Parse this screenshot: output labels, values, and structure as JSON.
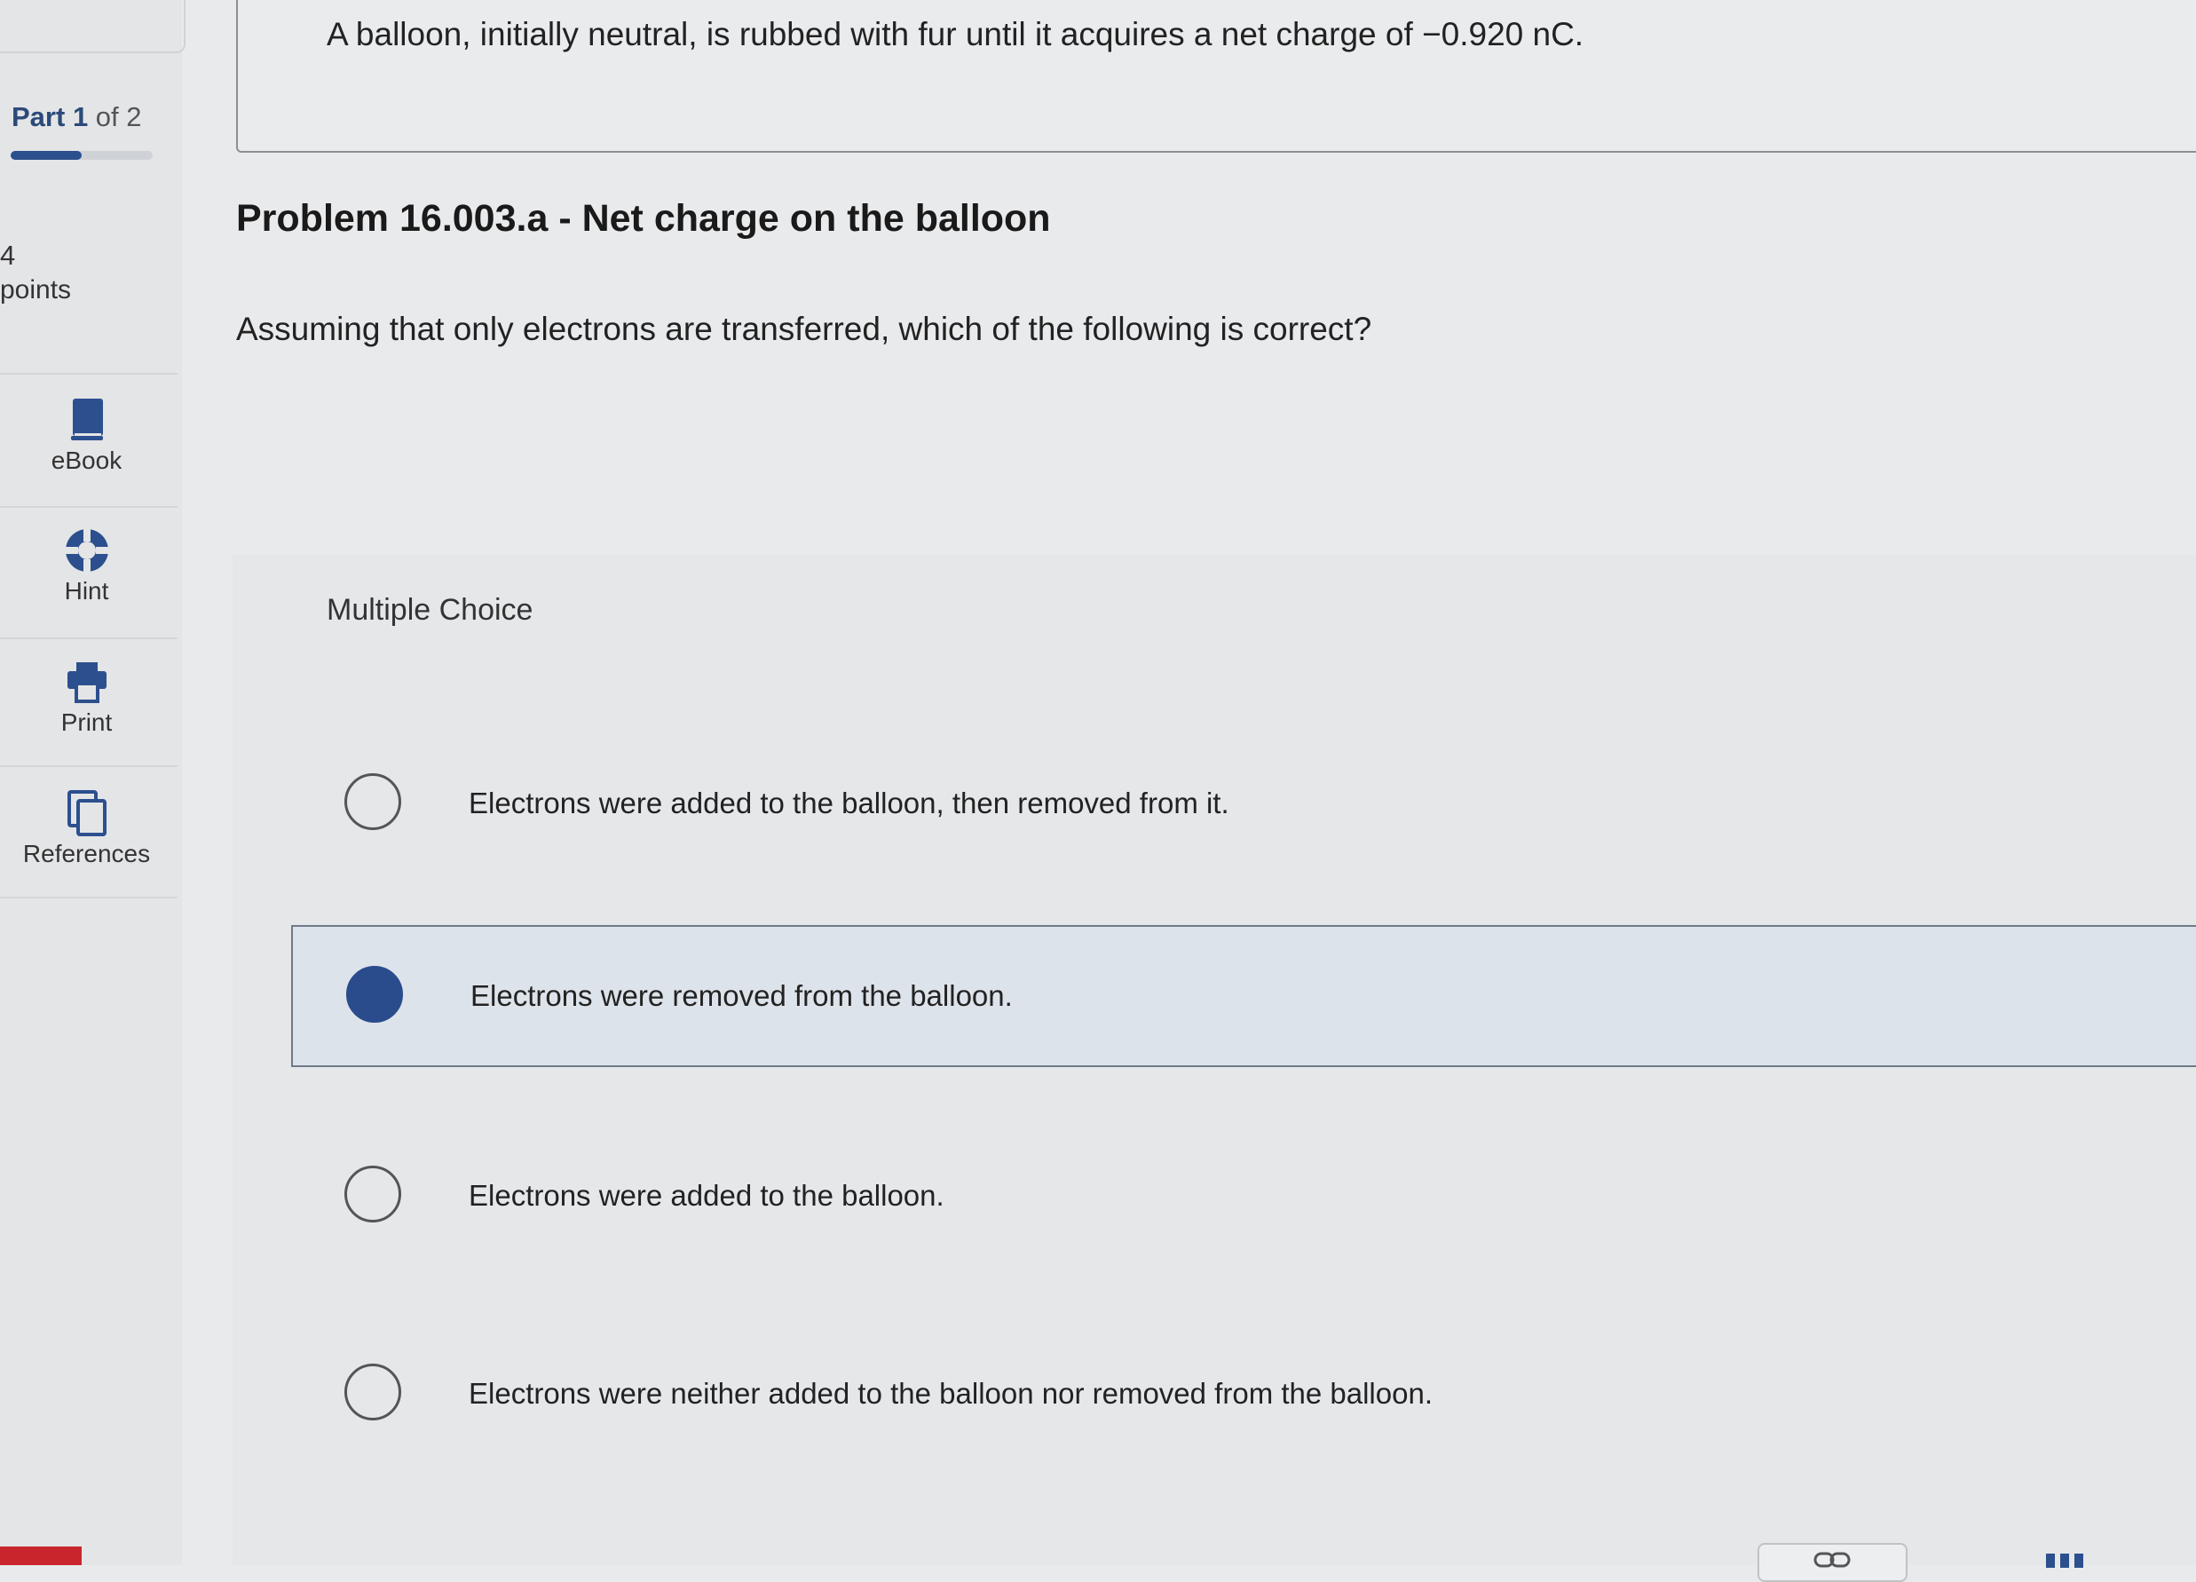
{
  "sidebar": {
    "part_word": "Part",
    "part_current": "1",
    "part_of_total": " of 2",
    "part_progress_fraction": 0.5,
    "points_value": "4",
    "points_label": "points",
    "tools": [
      {
        "label": "eBook",
        "icon": "book-icon"
      },
      {
        "label": "Hint",
        "icon": "lifebuoy-icon"
      },
      {
        "label": "Print",
        "icon": "printer-icon"
      },
      {
        "label": "References",
        "icon": "documents-icon"
      }
    ]
  },
  "question": {
    "text": "A balloon, initially neutral, is rubbed with fur until it acquires a net charge of −0.920 nC."
  },
  "problem": {
    "title": "Problem 16.003.a - Net charge on the balloon",
    "prompt": "Assuming that only electrons are transferred, which of the following is correct?"
  },
  "multiple_choice": {
    "heading": "Multiple Choice",
    "options": [
      {
        "label": "Electrons were added to the balloon, then removed from it.",
        "selected": false
      },
      {
        "label": "Electrons were removed from the balloon.",
        "selected": true
      },
      {
        "label": "Electrons were added to the balloon.",
        "selected": false
      },
      {
        "label": "Electrons were neither added to the balloon nor removed from the balloon.",
        "selected": false
      }
    ]
  },
  "colors": {
    "accent": "#2a4c8c",
    "brand": "#c8262c"
  }
}
